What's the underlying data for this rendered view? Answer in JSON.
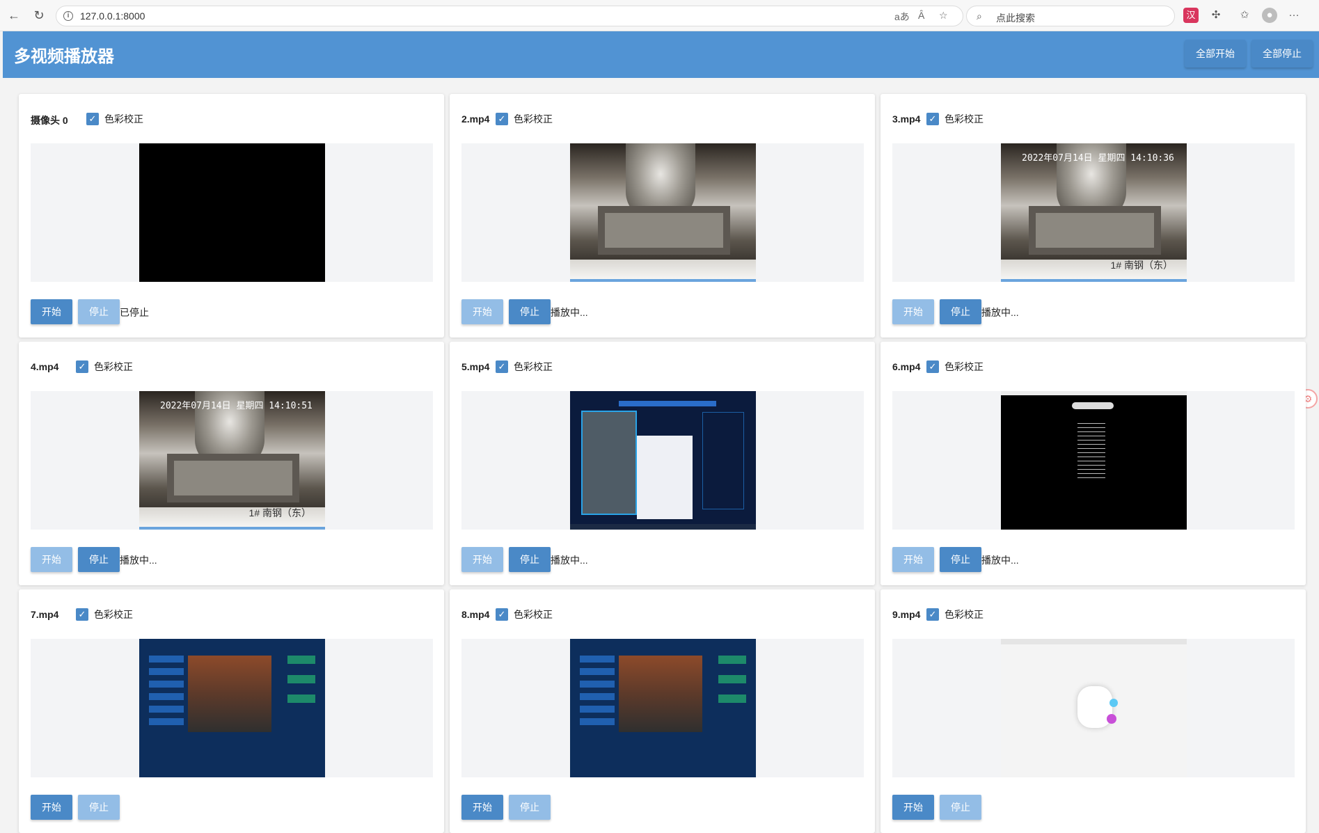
{
  "browser": {
    "url": "127.0.0.1:8000",
    "search_placeholder": "点此搜索",
    "icons": [
      "back-icon",
      "refresh-icon",
      "info-icon",
      "read-aloud-icon",
      "text-size-icon",
      "favorite-icon",
      "search-icon",
      "extension-icon",
      "puzzle-icon",
      "favorites-icon",
      "profile-icon",
      "more-icon"
    ],
    "translate_glyph": "aあ",
    "read_glyph": "Ȃ",
    "ext_badge": "汉"
  },
  "app": {
    "title": "多视频播放器",
    "start_all": "全部开始",
    "stop_all": "全部停止"
  },
  "labels": {
    "color_correction": "色彩校正",
    "start": "开始",
    "stop": "停止"
  },
  "cards": [
    {
      "name": "摄像头 0",
      "status": "已停止",
      "video": "black"
    },
    {
      "name": "2.mp4",
      "status": "播放中...",
      "video": "mine"
    },
    {
      "name": "3.mp4",
      "status": "播放中...",
      "video": "mine-stamped",
      "stamp": "2022年07月14日  星期四  14:10:36",
      "loc": "1# 南钢（东）"
    },
    {
      "name": "4.mp4",
      "status": "播放中...",
      "video": "mine-stamped",
      "stamp": "2022年07月14日  星期四  14:10:51",
      "loc": "1# 南钢（东）"
    },
    {
      "name": "5.mp4",
      "status": "播放中...",
      "video": "screen"
    },
    {
      "name": "6.mp4",
      "status": "播放中...",
      "video": "dark"
    },
    {
      "name": "7.mp4",
      "status": "",
      "video": "industrial"
    },
    {
      "name": "8.mp4",
      "status": "",
      "video": "industrial"
    },
    {
      "name": "9.mp4",
      "status": "",
      "video": "light"
    }
  ]
}
